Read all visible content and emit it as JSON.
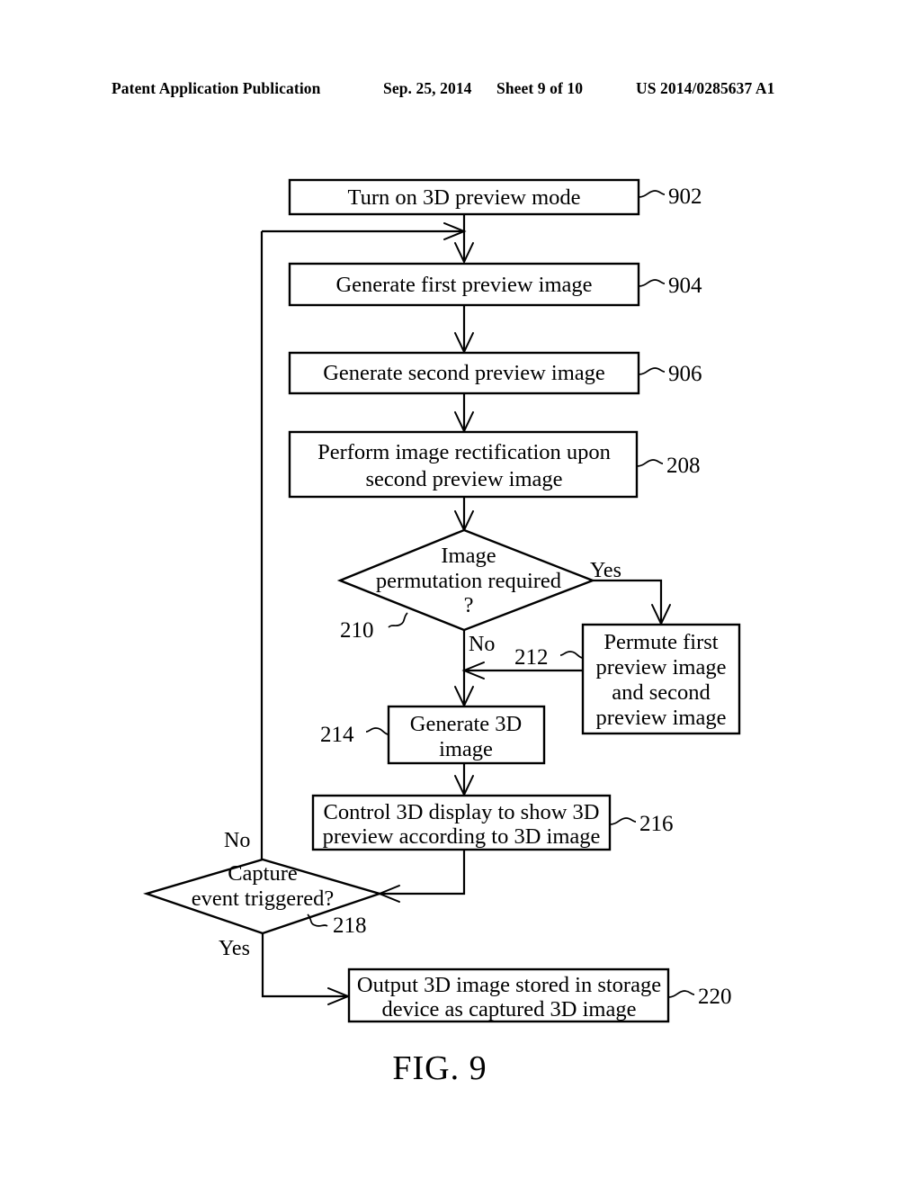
{
  "header": {
    "publication": "Patent Application Publication",
    "date": "Sep. 25, 2014",
    "sheet": "Sheet 9 of 10",
    "patent_number": "US 2014/0285637 A1"
  },
  "figure": {
    "caption": "FIG. 9"
  },
  "flowchart": {
    "nodes": [
      {
        "id": "n902",
        "ref": "902",
        "type": "process",
        "lines": [
          "Turn on 3D preview mode"
        ]
      },
      {
        "id": "n904",
        "ref": "904",
        "type": "process",
        "lines": [
          "Generate first preview image"
        ]
      },
      {
        "id": "n906",
        "ref": "906",
        "type": "process",
        "lines": [
          "Generate second preview image"
        ]
      },
      {
        "id": "n208",
        "ref": "208",
        "type": "process",
        "lines": [
          "Perform image rectification upon",
          "second preview image"
        ]
      },
      {
        "id": "n210",
        "ref": "210",
        "type": "decision",
        "lines": [
          "Image",
          "permutation required",
          "?"
        ]
      },
      {
        "id": "n212",
        "ref": "212",
        "type": "process",
        "lines": [
          "Permute first",
          "preview image",
          "and second",
          "preview image"
        ]
      },
      {
        "id": "n214",
        "ref": "214",
        "type": "process",
        "lines": [
          "Generate 3D",
          "image"
        ]
      },
      {
        "id": "n216",
        "ref": "216",
        "type": "process",
        "lines": [
          "Control 3D display to show 3D",
          "preview according to 3D image"
        ]
      },
      {
        "id": "n218",
        "ref": "218",
        "type": "decision",
        "lines": [
          "Capture",
          "event triggered?"
        ]
      },
      {
        "id": "n220",
        "ref": "220",
        "type": "process",
        "lines": [
          "Output 3D image stored in storage",
          "device as captured 3D image"
        ]
      }
    ],
    "branch_labels": {
      "d210_yes": "Yes",
      "d210_no": "No",
      "d218_no": "No",
      "d218_yes": "Yes"
    }
  }
}
